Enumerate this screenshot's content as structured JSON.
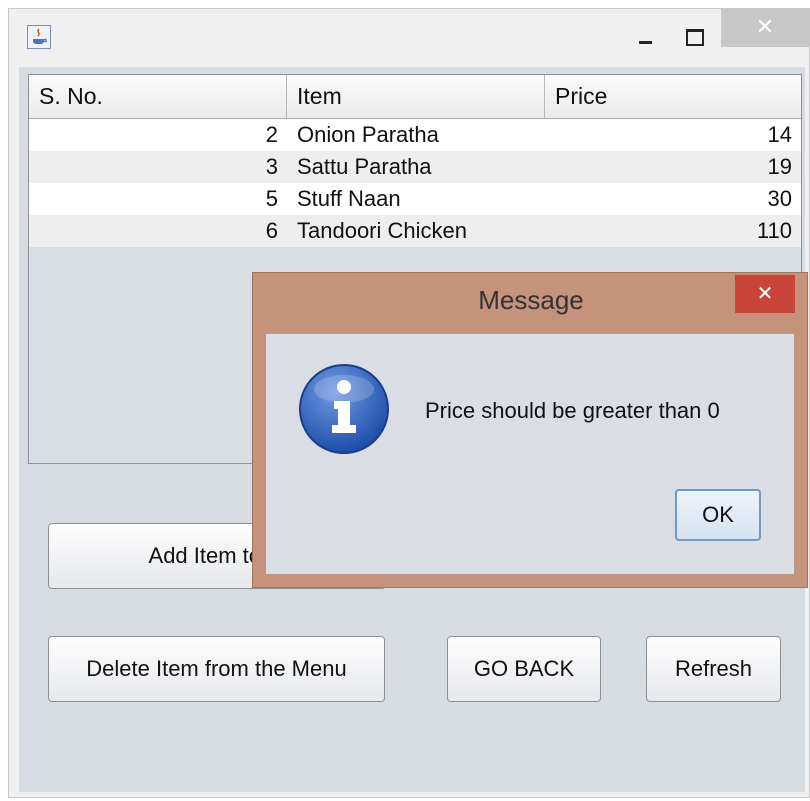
{
  "titlebar": {
    "close_glyph": "✕"
  },
  "table": {
    "headers": [
      "S. No.",
      "Item",
      "Price"
    ],
    "rows": [
      [
        "2",
        "Onion Paratha",
        "14"
      ],
      [
        "3",
        "Sattu Paratha",
        "19"
      ],
      [
        "5",
        "Stuff Naan",
        "30"
      ],
      [
        "6",
        "Tandoori Chicken",
        "110"
      ]
    ]
  },
  "buttons": {
    "add": "Add Item to M",
    "delete": "Delete Item from the Menu",
    "back": "GO BACK",
    "refresh": "Refresh"
  },
  "dialog": {
    "title": "Message",
    "close_glyph": "✕",
    "message": "Price should be greater than 0",
    "ok": "OK",
    "icon": "info-icon"
  }
}
